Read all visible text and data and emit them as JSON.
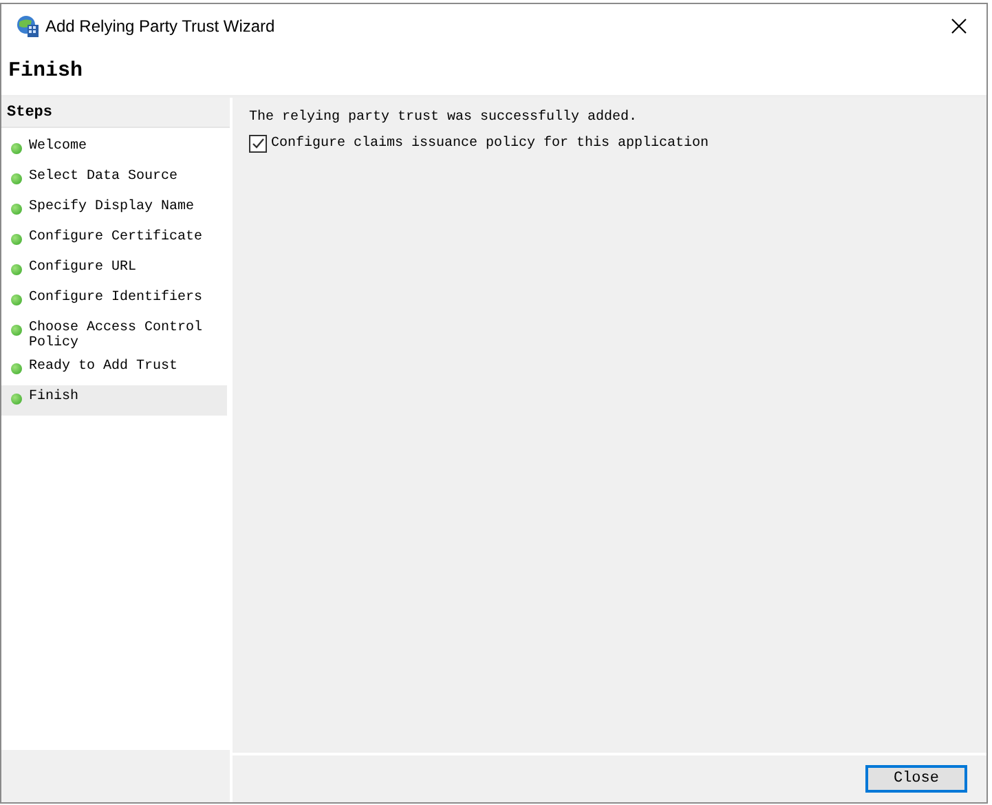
{
  "window": {
    "title": "Add Relying Party Trust Wizard"
  },
  "page_title": "Finish",
  "steps": {
    "heading": "Steps",
    "items": [
      {
        "label": "Welcome",
        "selected": false
      },
      {
        "label": "Select Data Source",
        "selected": false
      },
      {
        "label": "Specify Display Name",
        "selected": false
      },
      {
        "label": "Configure Certificate",
        "selected": false
      },
      {
        "label": "Configure URL",
        "selected": false
      },
      {
        "label": "Configure Identifiers",
        "selected": false
      },
      {
        "label": "Choose Access Control Policy",
        "selected": false
      },
      {
        "label": "Ready to Add Trust",
        "selected": false
      },
      {
        "label": "Finish",
        "selected": true
      }
    ]
  },
  "message": "The relying party trust was successfully added.",
  "checkbox": {
    "label": "Configure claims issuance policy for this application",
    "checked": true
  },
  "buttons": [
    "Close"
  ]
}
